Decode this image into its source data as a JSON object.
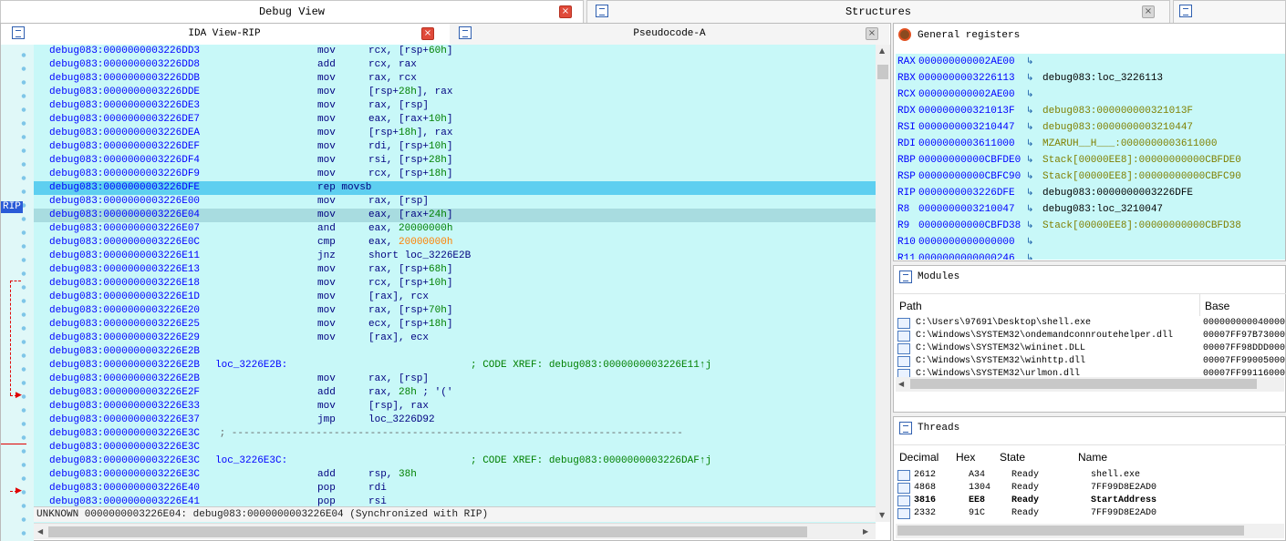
{
  "tabs": {
    "debug_view": "Debug View",
    "structures": "Structures",
    "close": "×"
  },
  "ida": {
    "title": "IDA View-RIP",
    "pseudocode": "Pseudocode-A",
    "rip_label": "RIP",
    "rows": [
      {
        "addr": "debug083:0000000003226DD3",
        "mn": "mov",
        "op": [
          [
            "rcx, [rsp+",
            ""
          ],
          [
            "60h",
            "n"
          ],
          [
            "]",
            ""
          ]
        ]
      },
      {
        "addr": "debug083:0000000003226DD8",
        "mn": "add",
        "op": [
          [
            "rcx, rax",
            ""
          ]
        ]
      },
      {
        "addr": "debug083:0000000003226DDB",
        "mn": "mov",
        "op": [
          [
            "rax, rcx",
            ""
          ]
        ]
      },
      {
        "addr": "debug083:0000000003226DDE",
        "mn": "mov",
        "op": [
          [
            "[rsp+",
            ""
          ],
          [
            "28h",
            "n"
          ],
          [
            "], rax",
            ""
          ]
        ]
      },
      {
        "addr": "debug083:0000000003226DE3",
        "mn": "mov",
        "op": [
          [
            "rax, [rsp]",
            ""
          ]
        ]
      },
      {
        "addr": "debug083:0000000003226DE7",
        "mn": "mov",
        "op": [
          [
            "eax, [rax+",
            ""
          ],
          [
            "10h",
            "n"
          ],
          [
            "]",
            ""
          ]
        ]
      },
      {
        "addr": "debug083:0000000003226DEA",
        "mn": "mov",
        "op": [
          [
            "[rsp+",
            ""
          ],
          [
            "18h",
            "n"
          ],
          [
            "], rax",
            ""
          ]
        ]
      },
      {
        "addr": "debug083:0000000003226DEF",
        "mn": "mov",
        "op": [
          [
            "rdi, [rsp+",
            ""
          ],
          [
            "10h",
            "n"
          ],
          [
            "]",
            ""
          ]
        ]
      },
      {
        "addr": "debug083:0000000003226DF4",
        "mn": "mov",
        "op": [
          [
            "rsi, [rsp+",
            ""
          ],
          [
            "28h",
            "n"
          ],
          [
            "]",
            ""
          ]
        ]
      },
      {
        "addr": "debug083:0000000003226DF9",
        "mn": "mov",
        "op": [
          [
            "rcx, [rsp+",
            ""
          ],
          [
            "18h",
            "n"
          ],
          [
            "]",
            ""
          ]
        ]
      },
      {
        "addr": "debug083:0000000003226DFE",
        "mn": "rep movsb",
        "op": [],
        "hl": "hl"
      },
      {
        "addr": "debug083:0000000003226E00",
        "mn": "mov",
        "op": [
          [
            "rax, [rsp]",
            ""
          ]
        ]
      },
      {
        "addr": "debug083:0000000003226E04",
        "mn": "mov",
        "op": [
          [
            "eax, [rax+",
            ""
          ],
          [
            "24h",
            "n"
          ],
          [
            "]",
            ""
          ]
        ],
        "hl": "hl2"
      },
      {
        "addr": "debug083:0000000003226E07",
        "mn": "and",
        "op": [
          [
            "eax, ",
            ""
          ],
          [
            "20000000h",
            "n"
          ]
        ]
      },
      {
        "addr": "debug083:0000000003226E0C",
        "mn": "cmp",
        "op": [
          [
            "eax, ",
            ""
          ],
          [
            "20000000h",
            "o"
          ]
        ]
      },
      {
        "addr": "debug083:0000000003226E11",
        "mn": "jnz",
        "op": [
          [
            "short loc_3226E2B",
            ""
          ]
        ]
      },
      {
        "addr": "debug083:0000000003226E13",
        "mn": "mov",
        "op": [
          [
            "rax, [rsp+",
            ""
          ],
          [
            "68h",
            "n"
          ],
          [
            "]",
            ""
          ]
        ]
      },
      {
        "addr": "debug083:0000000003226E18",
        "mn": "mov",
        "op": [
          [
            "rcx, [rsp+",
            ""
          ],
          [
            "10h",
            "n"
          ],
          [
            "]",
            ""
          ]
        ]
      },
      {
        "addr": "debug083:0000000003226E1D",
        "mn": "mov",
        "op": [
          [
            "[rax], rcx",
            ""
          ]
        ]
      },
      {
        "addr": "debug083:0000000003226E20",
        "mn": "mov",
        "op": [
          [
            "rax, [rsp+",
            ""
          ],
          [
            "70h",
            "n"
          ],
          [
            "]",
            ""
          ]
        ]
      },
      {
        "addr": "debug083:0000000003226E25",
        "mn": "mov",
        "op": [
          [
            "ecx, [rsp+",
            ""
          ],
          [
            "18h",
            "n"
          ],
          [
            "]",
            ""
          ]
        ]
      },
      {
        "addr": "debug083:0000000003226E29",
        "mn": "mov",
        "op": [
          [
            "[rax], ecx",
            ""
          ]
        ]
      },
      {
        "addr": "debug083:0000000003226E2B",
        "mn": "",
        "op": []
      },
      {
        "addr": "debug083:0000000003226E2B",
        "lbl": "loc_3226E2B:",
        "cmt": "; CODE XREF: debug083:0000000003226E11↑j"
      },
      {
        "addr": "debug083:0000000003226E2B",
        "mn": "mov",
        "op": [
          [
            "rax, [rsp]",
            ""
          ]
        ]
      },
      {
        "addr": "debug083:0000000003226E2F",
        "mn": "add",
        "op": [
          [
            "rax, ",
            ""
          ],
          [
            "28h",
            "n"
          ],
          [
            " ; '('",
            ""
          ]
        ]
      },
      {
        "addr": "debug083:0000000003226E33",
        "mn": "mov",
        "op": [
          [
            "[rsp], rax",
            ""
          ]
        ]
      },
      {
        "addr": "debug083:0000000003226E37",
        "mn": "jmp",
        "op": [
          [
            "loc_3226D92",
            ""
          ]
        ]
      },
      {
        "addr": "debug083:0000000003226E3C",
        "sepline": " ; ---------------------------------------------------------------------------"
      },
      {
        "addr": "debug083:0000000003226E3C",
        "mn": "",
        "op": []
      },
      {
        "addr": "debug083:0000000003226E3C",
        "lbl": "loc_3226E3C:",
        "cmt": "; CODE XREF: debug083:0000000003226DAF↑j"
      },
      {
        "addr": "debug083:0000000003226E3C",
        "mn": "add",
        "op": [
          [
            "rsp, ",
            ""
          ],
          [
            "38h",
            "n"
          ]
        ]
      },
      {
        "addr": "debug083:0000000003226E40",
        "mn": "pop",
        "op": [
          [
            "rdi",
            ""
          ]
        ]
      },
      {
        "addr": "debug083:0000000003226E41",
        "mn": "pop",
        "op": [
          [
            "rsi",
            ""
          ]
        ]
      }
    ],
    "status": "UNKNOWN 0000000003226E04: debug083:0000000003226E04 (Synchronized with RIP)"
  },
  "registers": {
    "title": "General registers",
    "rows": [
      {
        "n": "RAX",
        "v": "000000000002AE00",
        "d": "",
        "c": ""
      },
      {
        "n": "RBX",
        "v": "0000000003226113",
        "d": "debug083:loc_3226113",
        "c": ""
      },
      {
        "n": "RCX",
        "v": "000000000002AE00",
        "d": "",
        "c": ""
      },
      {
        "n": "RDX",
        "v": "000000000321013F",
        "d": "debug083:000000000321013F",
        "c": "ol"
      },
      {
        "n": "RSI",
        "v": "0000000003210447",
        "d": "debug083:0000000003210447",
        "c": "ol"
      },
      {
        "n": "RDI",
        "v": "0000000003611000",
        "d": "MZARUH__H___:0000000003611000",
        "c": "ol"
      },
      {
        "n": "RBP",
        "v": "00000000000CBFDE0",
        "d": "Stack[00000EE8]:00000000000CBFDE0",
        "c": "ol"
      },
      {
        "n": "RSP",
        "v": "00000000000CBFC90",
        "d": "Stack[00000EE8]:00000000000CBFC90",
        "c": "ol"
      },
      {
        "n": "RIP",
        "v": "0000000003226DFE",
        "d": "debug083:0000000003226DFE",
        "c": ""
      },
      {
        "n": "R8",
        "v": "0000000003210047",
        "d": "debug083:loc_3210047",
        "c": ""
      },
      {
        "n": "R9",
        "v": "00000000000CBFD38",
        "d": "Stack[00000EE8]:00000000000CBFD38",
        "c": "ol"
      },
      {
        "n": "R10",
        "v": "0000000000000000",
        "d": "",
        "c": ""
      },
      {
        "n": "R11",
        "v": "0000000000000246",
        "d": "",
        "c": ""
      }
    ],
    "arrow": "↳"
  },
  "modules": {
    "title": "Modules",
    "col_path": "Path",
    "col_base": "Base",
    "rows": [
      {
        "p": "C:\\Users\\97691\\Desktop\\shell.exe",
        "b": "000000000040000"
      },
      {
        "p": "C:\\Windows\\SYSTEM32\\ondemandconnroutehelper.dll",
        "b": "00007FF97B73000"
      },
      {
        "p": "C:\\Windows\\SYSTEM32\\wininet.DLL",
        "b": "00007FF98DDD000"
      },
      {
        "p": "C:\\Windows\\SYSTEM32\\winhttp.dll",
        "b": "00007FF99005000"
      },
      {
        "p": "C:\\Windows\\SYSTEM32\\urlmon.dll",
        "b": "00007FF99116000"
      }
    ]
  },
  "threads": {
    "title": "Threads",
    "cols": [
      "Decimal",
      "Hex",
      "State",
      "Name"
    ],
    "rows": [
      {
        "d": "2612",
        "h": "A34",
        "s": "Ready",
        "n": "shell.exe",
        "b": false
      },
      {
        "d": "4868",
        "h": "1304",
        "s": "Ready",
        "n": "7FF99D8E2AD0",
        "b": false
      },
      {
        "d": "3816",
        "h": "EE8",
        "s": "Ready",
        "n": "StartAddress",
        "b": true
      },
      {
        "d": "2332",
        "h": "91C",
        "s": "Ready",
        "n": "7FF99D8E2AD0",
        "b": false
      }
    ]
  }
}
